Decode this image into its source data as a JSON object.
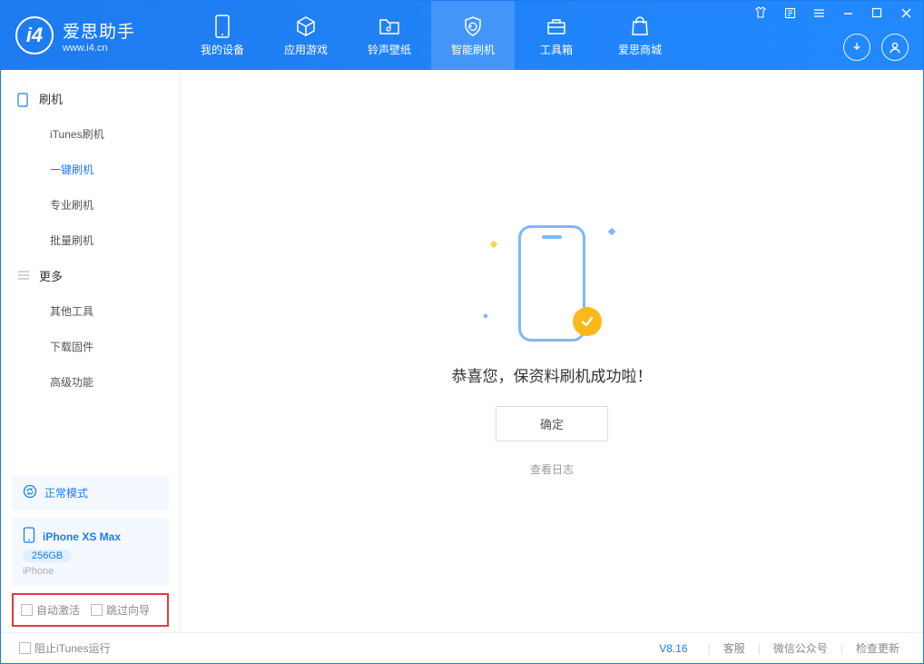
{
  "app": {
    "name": "爱思助手",
    "url": "www.i4.cn"
  },
  "nav": {
    "device": "我的设备",
    "apps": "应用游戏",
    "ringtone": "铃声壁纸",
    "flash": "智能刷机",
    "toolbox": "工具箱",
    "store": "爱思商城"
  },
  "sidebar": {
    "group_flash": "刷机",
    "items_flash": [
      "iTunes刷机",
      "一键刷机",
      "专业刷机",
      "批量刷机"
    ],
    "group_more": "更多",
    "items_more": [
      "其他工具",
      "下载固件",
      "高级功能"
    ],
    "mode": "正常模式",
    "device": {
      "name": "iPhone XS Max",
      "storage": "256GB",
      "type": "iPhone"
    },
    "chk_activate": "自动激活",
    "chk_skip": "跳过向导"
  },
  "main": {
    "result": "恭喜您，保资料刷机成功啦！",
    "ok": "确定",
    "log": "查看日志"
  },
  "footer": {
    "block_itunes": "阻止iTunes运行",
    "version": "V8.16",
    "support": "客服",
    "wechat": "微信公众号",
    "update": "检查更新"
  }
}
